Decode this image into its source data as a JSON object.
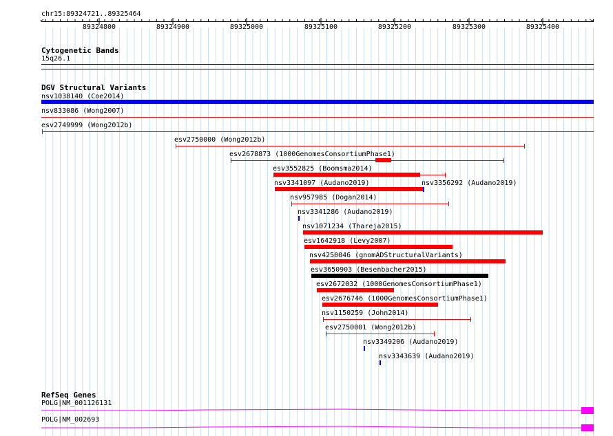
{
  "ruler": {
    "range_label": "chr15:89324721..89325464",
    "ticks": [
      "89324800",
      "89324900",
      "89325000",
      "89325100",
      "89325200",
      "89325300",
      "89325400"
    ]
  },
  "cytoband": {
    "title": "Cytogenetic Bands",
    "band": "15q26.1"
  },
  "dgv": {
    "title": "DGV Structural Variants",
    "colors": {
      "gain": "#0000ff",
      "loss": "#ff0000",
      "complex": "#000000"
    },
    "variants": [
      {
        "label": "nsv1038140 (Coe2014)",
        "color": "#0000ff"
      },
      {
        "label": "nsv833086 (Wong2007)",
        "color": "#ff0000"
      },
      {
        "label": "esv2749999 (Wong2012b)",
        "color": "#ff0000"
      },
      {
        "label": "esv2750000 (Wong2012b)",
        "color": "#ff0000"
      },
      {
        "label": "esv2678873 (1000GenomesConsortiumPhase1)",
        "color": "#ff0000"
      },
      {
        "label": "esv3552825 (Boomsma2014)",
        "color": "#ff0000"
      },
      {
        "label": "nsv3341097 (Audano2019)",
        "color": "#ff0000"
      },
      {
        "label": "nsv3356292 (Audano2019)",
        "color": "#0000ff"
      },
      {
        "label": "nsv957985 (Dogan2014)",
        "color": "#ff0000"
      },
      {
        "label": "nsv3341286 (Audano2019)",
        "color": "#0000ff"
      },
      {
        "label": "nsv1071234 (Thareja2015)",
        "color": "#ff0000"
      },
      {
        "label": "esv1642918 (Levy2007)",
        "color": "#ff0000"
      },
      {
        "label": "nsv4250046 (gnomADStructuralVariants)",
        "color": "#ff0000"
      },
      {
        "label": "esv3650903 (Besenbacher2015)",
        "color": "#000000"
      },
      {
        "label": "esv2672032 (1000GenomesConsortiumPhase1)",
        "color": "#ff0000"
      },
      {
        "label": "esv2676746 (1000GenomesConsortiumPhase1)",
        "color": "#ff0000"
      },
      {
        "label": "nsv1150259 (John2014)",
        "color": "#ff0000"
      },
      {
        "label": "esv2750001 (Wong2012b)",
        "color": "#ff0000"
      },
      {
        "label": "nsv3349206 (Audano2019)",
        "color": "#0000ff"
      },
      {
        "label": "nsv3343639 (Audano2019)",
        "color": "#0000ff"
      }
    ]
  },
  "refseq": {
    "title": "RefSeq Genes",
    "color": "#ff00ff",
    "genes": [
      {
        "label": "POLG|NM_001126131"
      },
      {
        "label": "POLG|NM_002693"
      }
    ]
  }
}
